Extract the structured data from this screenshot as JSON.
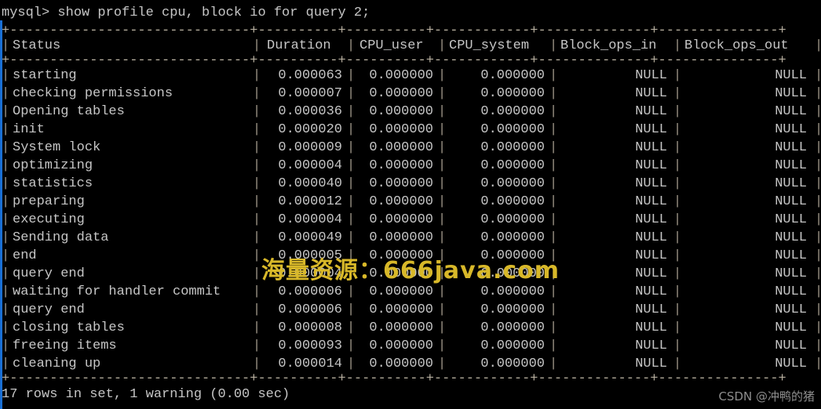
{
  "terminal": {
    "prompt": "mysql> show profile cpu, block io for query 2;",
    "rule": "+------------------------------+----------+----------+------------+--------------+---------------+",
    "footer": "17 rows in set, 1 warning (0.00 sec)"
  },
  "table": {
    "columns": [
      "Status",
      "Duration",
      "CPU_user",
      "CPU_system",
      "Block_ops_in",
      "Block_ops_out"
    ],
    "rows": [
      {
        "status": "starting",
        "duration": "0.000063",
        "cpu_user": "0.000000",
        "cpu_system": "0.000000",
        "block_ops_in": "NULL",
        "block_ops_out": "NULL"
      },
      {
        "status": "checking permissions",
        "duration": "0.000007",
        "cpu_user": "0.000000",
        "cpu_system": "0.000000",
        "block_ops_in": "NULL",
        "block_ops_out": "NULL"
      },
      {
        "status": "Opening tables",
        "duration": "0.000036",
        "cpu_user": "0.000000",
        "cpu_system": "0.000000",
        "block_ops_in": "NULL",
        "block_ops_out": "NULL"
      },
      {
        "status": "init",
        "duration": "0.000020",
        "cpu_user": "0.000000",
        "cpu_system": "0.000000",
        "block_ops_in": "NULL",
        "block_ops_out": "NULL"
      },
      {
        "status": "System lock",
        "duration": "0.000009",
        "cpu_user": "0.000000",
        "cpu_system": "0.000000",
        "block_ops_in": "NULL",
        "block_ops_out": "NULL"
      },
      {
        "status": "optimizing",
        "duration": "0.000004",
        "cpu_user": "0.000000",
        "cpu_system": "0.000000",
        "block_ops_in": "NULL",
        "block_ops_out": "NULL"
      },
      {
        "status": "statistics",
        "duration": "0.000040",
        "cpu_user": "0.000000",
        "cpu_system": "0.000000",
        "block_ops_in": "NULL",
        "block_ops_out": "NULL"
      },
      {
        "status": "preparing",
        "duration": "0.000012",
        "cpu_user": "0.000000",
        "cpu_system": "0.000000",
        "block_ops_in": "NULL",
        "block_ops_out": "NULL"
      },
      {
        "status": "executing",
        "duration": "0.000004",
        "cpu_user": "0.000000",
        "cpu_system": "0.000000",
        "block_ops_in": "NULL",
        "block_ops_out": "NULL"
      },
      {
        "status": "Sending data",
        "duration": "0.000049",
        "cpu_user": "0.000000",
        "cpu_system": "0.000000",
        "block_ops_in": "NULL",
        "block_ops_out": "NULL"
      },
      {
        "status": "end",
        "duration": "0.000005",
        "cpu_user": "0.000000",
        "cpu_system": "0.000000",
        "block_ops_in": "NULL",
        "block_ops_out": "NULL"
      },
      {
        "status": "query end",
        "duration": "0.000004",
        "cpu_user": "0.000000",
        "cpu_system": "0.000000",
        "block_ops_in": "NULL",
        "block_ops_out": "NULL"
      },
      {
        "status": "waiting for handler commit",
        "duration": "0.000006",
        "cpu_user": "0.000000",
        "cpu_system": "0.000000",
        "block_ops_in": "NULL",
        "block_ops_out": "NULL"
      },
      {
        "status": "query end",
        "duration": "0.000006",
        "cpu_user": "0.000000",
        "cpu_system": "0.000000",
        "block_ops_in": "NULL",
        "block_ops_out": "NULL"
      },
      {
        "status": "closing tables",
        "duration": "0.000008",
        "cpu_user": "0.000000",
        "cpu_system": "0.000000",
        "block_ops_in": "NULL",
        "block_ops_out": "NULL"
      },
      {
        "status": "freeing items",
        "duration": "0.000093",
        "cpu_user": "0.000000",
        "cpu_system": "0.000000",
        "block_ops_in": "NULL",
        "block_ops_out": "NULL"
      },
      {
        "status": "cleaning up",
        "duration": "0.000014",
        "cpu_user": "0.000000",
        "cpu_system": "0.000000",
        "block_ops_in": "NULL",
        "block_ops_out": "NULL"
      }
    ]
  },
  "overlays": {
    "watermark": "海量资源：666java.com",
    "csdn_credit": "CSDN @冲鸭的猪"
  },
  "colors": {
    "background": "#000000",
    "text": "#c6c6c6",
    "rule": "#b8b0a0",
    "left_rail": "#1a6fd4",
    "watermark": "#d8b829",
    "csdn": "#8d8d8d"
  }
}
